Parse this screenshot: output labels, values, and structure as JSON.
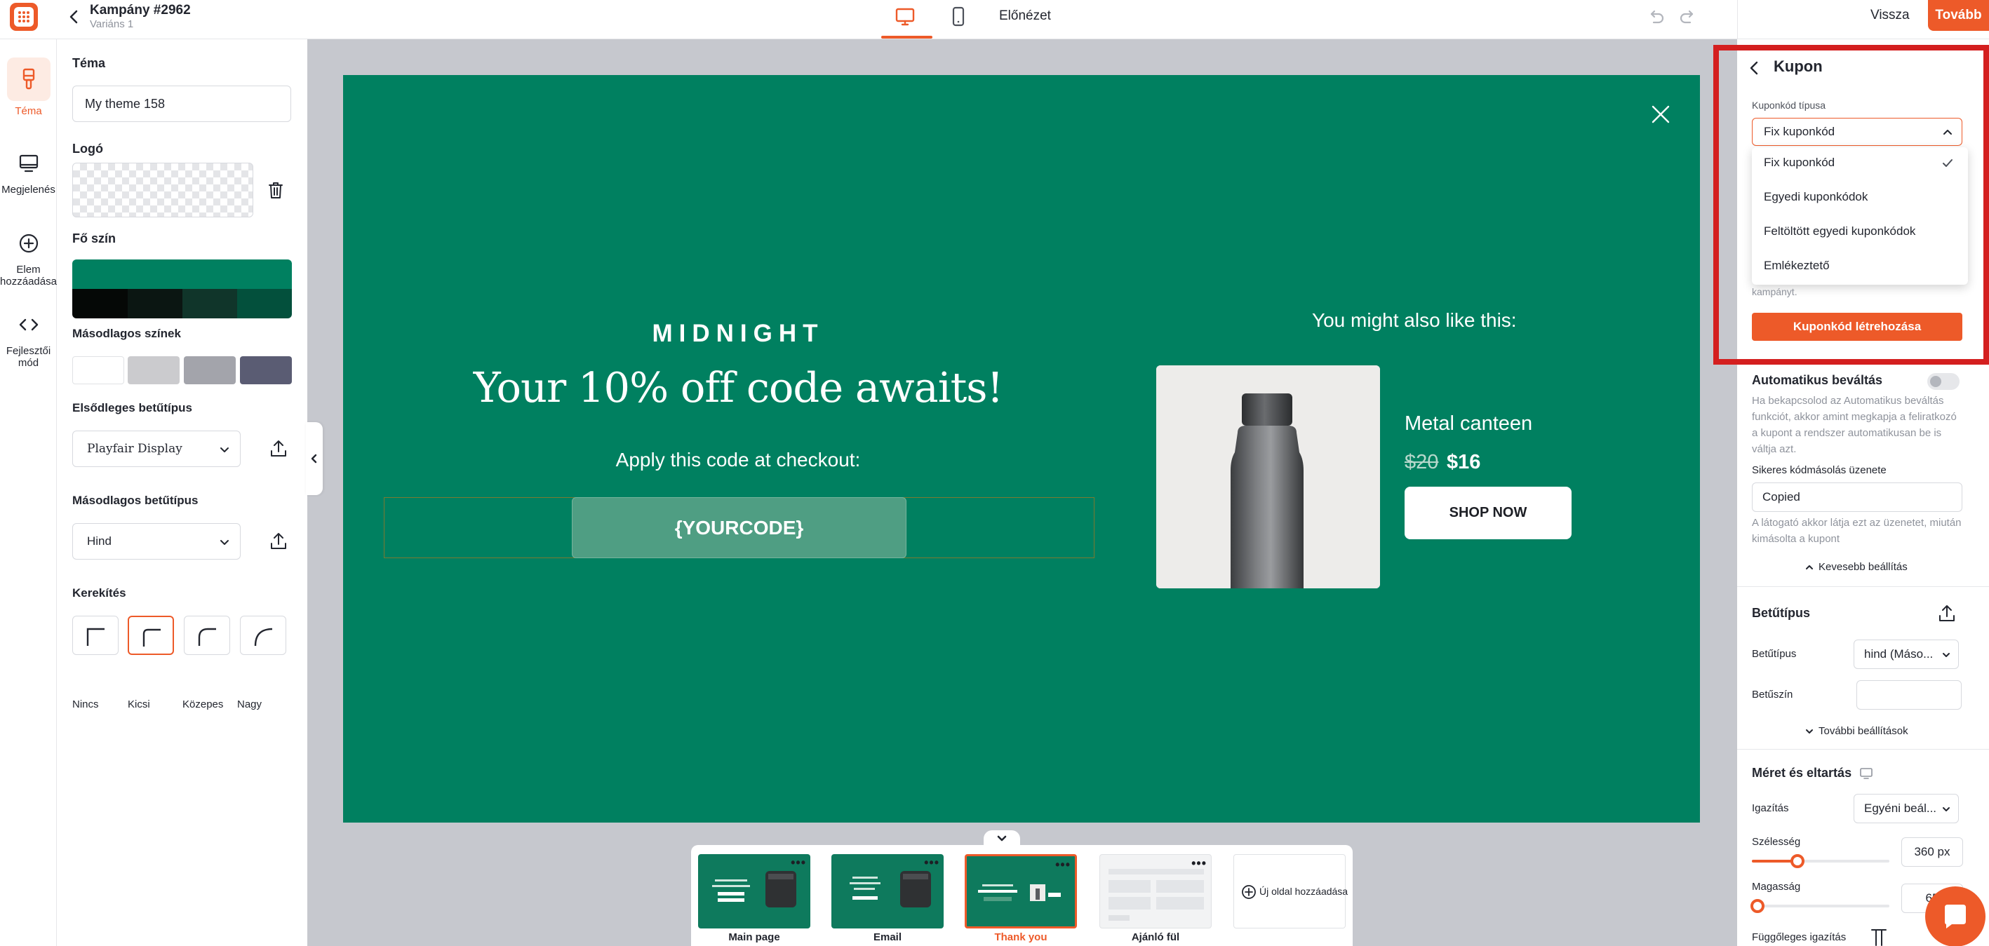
{
  "header": {
    "campaign_title": "Kampány #2962",
    "variant": "Variáns 1",
    "preview_label": "Előnézet",
    "back_label": "Vissza",
    "next_label": "Tovább"
  },
  "rail": {
    "items": [
      {
        "label": "Téma",
        "icon": "brush-icon",
        "active": true
      },
      {
        "label": "Megjelenés",
        "icon": "monitor-icon"
      },
      {
        "label": "Elem hozzáadása",
        "icon": "plus-circle-icon"
      },
      {
        "label": "Fejlesztői mód",
        "icon": "code-icon"
      }
    ]
  },
  "left_panel": {
    "theme_label": "Téma",
    "theme_name": "My theme 158",
    "logo_label": "Logó",
    "main_color_label": "Fő szín",
    "main_color": "#008060",
    "main_shades": [
      "#050806",
      "#0b1612",
      "#10352a",
      "#03503c"
    ],
    "secondary_colors_label": "Másodlagos színek",
    "secondary_colors": [
      "#ffffff",
      "#cbcbce",
      "#a3a4ab",
      "#5a5c73"
    ],
    "primary_font_label": "Elsődleges betűtípus",
    "primary_font": "Playfair Display",
    "secondary_font_label": "Másodlagos betűtípus",
    "secondary_font": "Hind",
    "rounding_label": "Kerekítés",
    "rounding_options": [
      "Nincs",
      "Kicsi",
      "Közepes",
      "Nagy"
    ],
    "rounding_selected": "Kicsi"
  },
  "popup": {
    "background": "#008060",
    "brand": "MIDNIGHT",
    "headline": "Your 10% off code awaits!",
    "subline": "Apply this code at checkout:",
    "coupon_code": "{YOURCODE}",
    "recommend_title": "You might also like this:",
    "product_name": "Metal canteen",
    "old_price": "$20",
    "new_price": "$16",
    "cta": "SHOP NOW"
  },
  "pages": [
    {
      "label": "Main page",
      "style": "green"
    },
    {
      "label": "Email",
      "style": "green"
    },
    {
      "label": "Thank you",
      "style": "green",
      "active": true
    },
    {
      "label": "Ajánló fül",
      "style": "grey"
    }
  ],
  "add_page_label": "Új oldal hozzáadása",
  "right_panel": {
    "title": "Kupon",
    "coupon_type_label": "Kuponkód típusa",
    "coupon_type_value": "Fix kuponkód",
    "coupon_type_options": [
      "Fix kuponkód",
      "Egyedi kuponkódok",
      "Feltöltött egyedi kuponkódok",
      "Emlékeztető"
    ],
    "hint_tail": "kampányt.",
    "create_button": "Kuponkód létrehozása",
    "auto_redeem_label": "Automatikus beváltás",
    "auto_redeem_desc": "Ha bekapcsolod az Automatikus beváltás funkciót, akkor amint megkapja a feliratkozó a kupont a rendszer automatikusan be is váltja azt.",
    "copy_message_label": "Sikeres kódmásolás üzenete",
    "copy_message_value": "Copied",
    "copy_message_desc": "A látogató akkor látja ezt az üzenetet, miután kimásolta a kupont",
    "less_settings": "Kevesebb beállítás",
    "font_section": "Betűtípus",
    "font_label": "Betűtípus",
    "font_value": "hind (Máso...",
    "font_color_label": "Betűszín",
    "more_settings": "További beállítások",
    "size_section": "Méret és eltartás",
    "align_label": "Igazítás",
    "align_value": "Egyéni beál...",
    "width_label": "Szélesség",
    "width_value": "360 px",
    "width_slider": 0.33,
    "height_label": "Magasság",
    "height_value": "65",
    "height_slider": 0.04,
    "vertical_align_label": "Függőleges igazítás"
  }
}
